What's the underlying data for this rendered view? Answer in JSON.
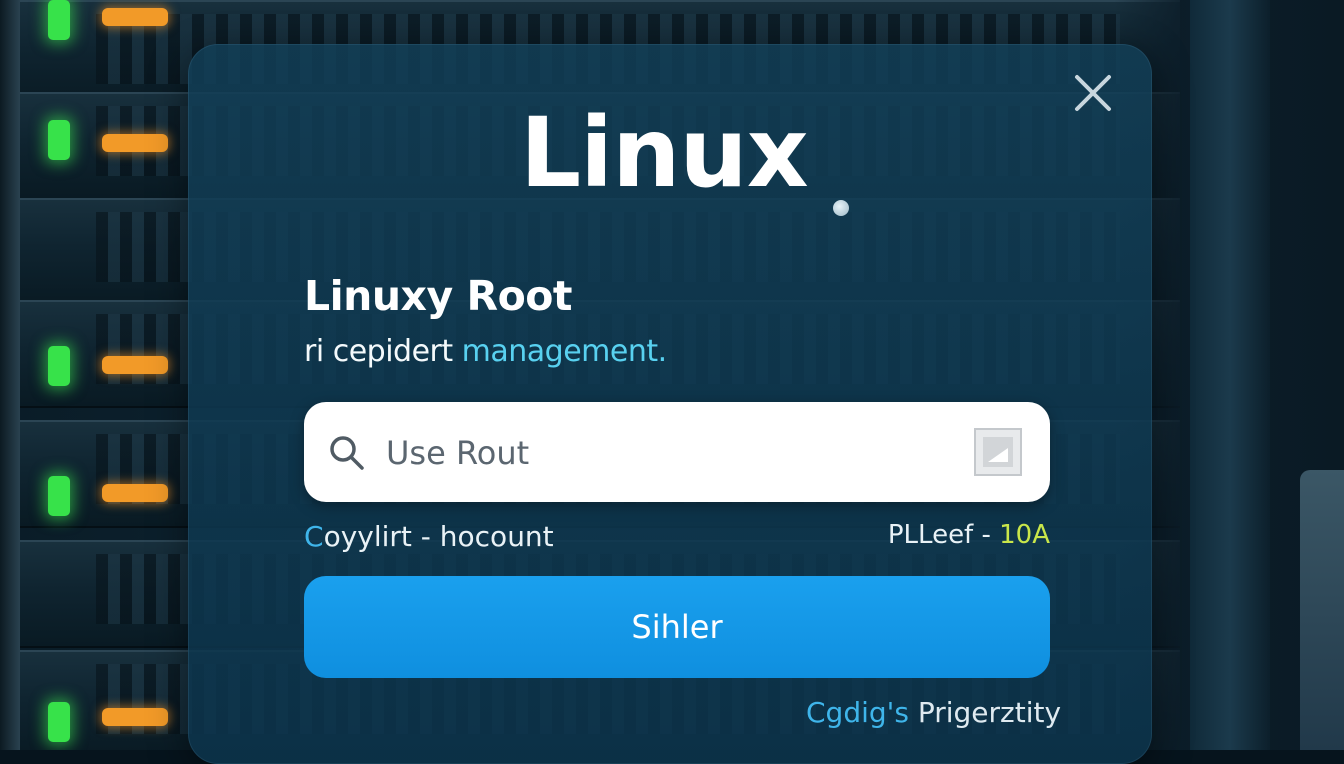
{
  "dialog": {
    "logo_text": "Linux",
    "title": "Linuxy Root",
    "subtitle_plain": "ri cepidert ",
    "subtitle_highlight": "management.",
    "search": {
      "placeholder": "Use Rout",
      "icon": "search-icon",
      "trailing_icon": "square-button-icon"
    },
    "links": {
      "left_accent": "C",
      "left_rest": "oyylirt - hocount",
      "right_plain": "PLLeef - ",
      "right_accent": "10A"
    },
    "submit_label": "Sihler",
    "footer": {
      "accent": "Cgdig's",
      "rest": " Prigerztity"
    },
    "close_icon": "close-icon"
  },
  "colors": {
    "accent_blue": "#1aa0ee",
    "cyan_text": "#58d1f0",
    "yellow_text": "#c9e64a",
    "led_green": "#37e24a",
    "led_orange": "#f29a28"
  }
}
